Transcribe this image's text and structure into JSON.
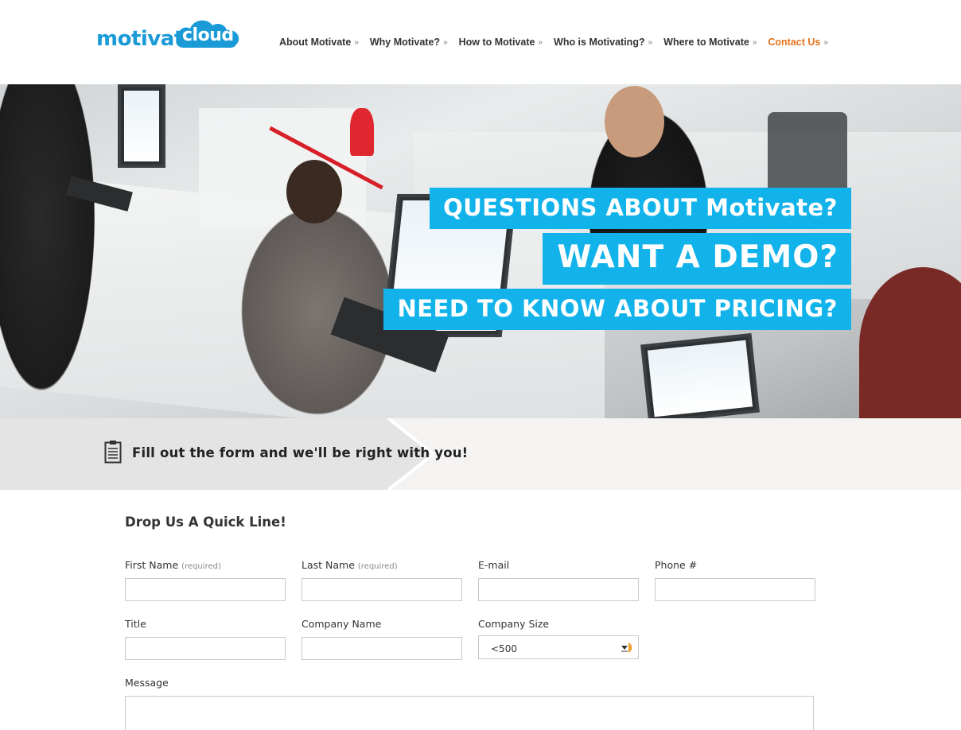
{
  "brand": {
    "logo_part1": "motivate",
    "logo_part2": "cloud"
  },
  "nav": {
    "items": [
      {
        "label": "About Motivate",
        "active": false
      },
      {
        "label": "Why Motivate?",
        "active": false
      },
      {
        "label": "How to Motivate",
        "active": false
      },
      {
        "label": "Who is Motivating?",
        "active": false
      },
      {
        "label": "Where to Motivate",
        "active": false
      },
      {
        "label": "Contact Us",
        "active": true
      }
    ],
    "chevron": "»",
    "active_color": "#e8731b"
  },
  "hero": {
    "line1": "QUESTIONS ABOUT Motivate?",
    "line2": "WANT A DEMO?",
    "line3": "NEED TO KNOW ABOUT PRICING?",
    "accent_color": "#12b3ea"
  },
  "ribbon": {
    "icon": "clipboard-icon",
    "text": "Fill out the form and we'll be right with you!"
  },
  "form": {
    "title": "Drop Us A Quick Line!",
    "required_note": "(required)",
    "fields": {
      "first_name": {
        "label": "First Name",
        "value": ""
      },
      "last_name": {
        "label": "Last Name",
        "value": ""
      },
      "email": {
        "label": "E-mail",
        "value": ""
      },
      "phone": {
        "label": "Phone #",
        "value": ""
      },
      "title": {
        "label": "Title",
        "value": ""
      },
      "company_name": {
        "label": "Company Name",
        "value": ""
      },
      "company_size": {
        "label": "Company Size",
        "value": "<500"
      },
      "message": {
        "label": "Message",
        "value": ""
      }
    }
  }
}
